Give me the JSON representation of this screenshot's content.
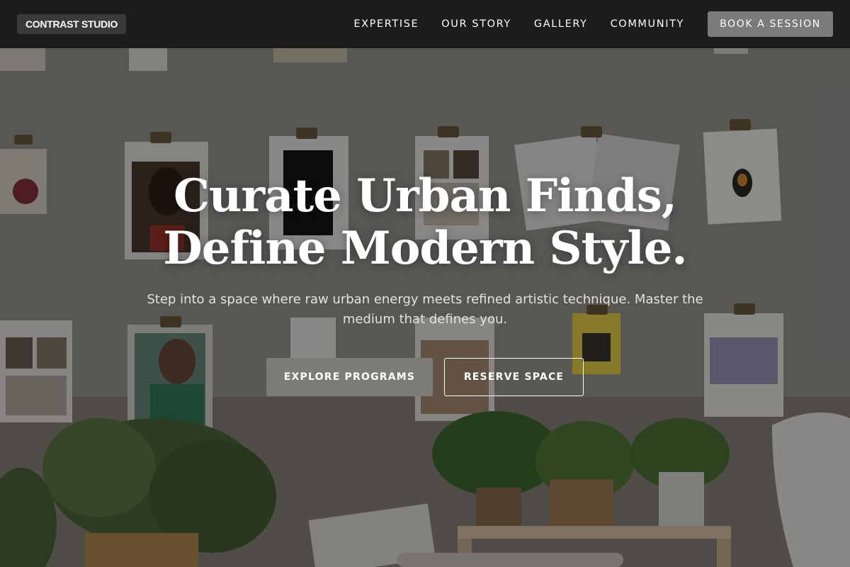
{
  "nav": {
    "logo": "CONTRAST STUDIO",
    "links": [
      "EXPERTISE",
      "OUR STORY",
      "GALLERY",
      "COMMUNITY"
    ],
    "cta": "BOOK A SESSION"
  },
  "hero": {
    "headline_line1": "Curate Urban Finds,",
    "headline_line2": "Define Modern Style.",
    "subtext": "Step into a space where raw urban energy meets refined artistic technique. Master the medium that defines you.",
    "primary_button": "EXPLORE PROGRAMS",
    "secondary_button": "RESERVE SPACE"
  },
  "colors": {
    "nav_background": "#141414",
    "primary_button": "#7e7c79",
    "text": "#ffffff"
  }
}
